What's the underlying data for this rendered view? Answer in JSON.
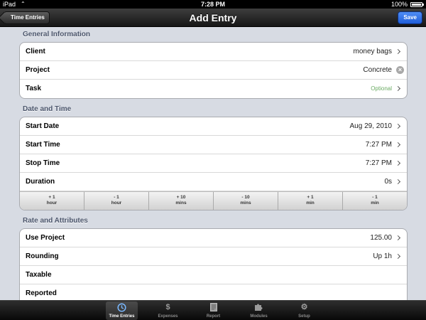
{
  "status_bar": {
    "carrier": "iPad",
    "time": "7:28 PM",
    "battery": "100%"
  },
  "nav": {
    "back_label": "Time Entries",
    "title": "Add Entry",
    "save_label": "Save"
  },
  "sections": {
    "general": {
      "header": "General Information",
      "rows": [
        {
          "label": "Client",
          "value": "money bags"
        },
        {
          "label": "Project",
          "value": "Concrete"
        },
        {
          "label": "Task",
          "value": "Optional"
        }
      ]
    },
    "datetime": {
      "header": "Date and Time",
      "rows": [
        {
          "label": "Start Date",
          "value": "Aug 29, 2010"
        },
        {
          "label": "Start Time",
          "value": "7:27 PM"
        },
        {
          "label": "Stop Time",
          "value": "7:27 PM"
        },
        {
          "label": "Duration",
          "value": "0s"
        }
      ],
      "adjust": [
        {
          "top": "+ 1",
          "bottom": "hour"
        },
        {
          "top": "- 1",
          "bottom": "hour"
        },
        {
          "top": "+ 10",
          "bottom": "mins"
        },
        {
          "top": "- 10",
          "bottom": "mins"
        },
        {
          "top": "+ 1",
          "bottom": "min"
        },
        {
          "top": "- 1",
          "bottom": "min"
        }
      ]
    },
    "rate": {
      "header": "Rate and Attributes",
      "rows": [
        {
          "label": "Use Project",
          "value": "125.00"
        },
        {
          "label": "Rounding",
          "value": "Up 1h"
        },
        {
          "label": "Taxable",
          "value": ""
        },
        {
          "label": "Reported",
          "value": ""
        }
      ]
    }
  },
  "tabs": [
    {
      "label": "Time Entries",
      "icon": "clock-icon",
      "active": true
    },
    {
      "label": "Expenses",
      "icon": "dollar-icon",
      "active": false
    },
    {
      "label": "Report",
      "icon": "report-icon",
      "active": false
    },
    {
      "label": "Modules",
      "icon": "puzzle-icon",
      "active": false
    },
    {
      "label": "Setup",
      "icon": "gear-icon",
      "active": false
    }
  ],
  "colors": {
    "save_button": "#2d6be6",
    "optional_text": "#6bab63",
    "section_header": "#4c566c"
  }
}
